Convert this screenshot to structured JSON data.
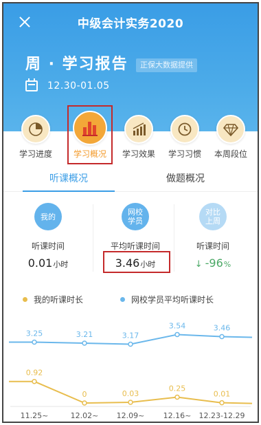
{
  "app": {
    "title": "中级会计实务2020"
  },
  "report": {
    "title": "周 · 学习报告",
    "source_tag": "正保大数据提供",
    "date_range": "12.30-01.05"
  },
  "categories": [
    {
      "label": "学习进度",
      "icon": "pie-chart-icon"
    },
    {
      "label": "学习概况",
      "icon": "bar-chart-icon",
      "active": true
    },
    {
      "label": "学习效果",
      "icon": "rising-bars-icon"
    },
    {
      "label": "学习习惯",
      "icon": "clock-icon"
    },
    {
      "label": "本周段位",
      "icon": "diamond-icon"
    }
  ],
  "tabs": [
    {
      "label": "听课概况",
      "active": true
    },
    {
      "label": "做题概况",
      "active": false
    }
  ],
  "stats": [
    {
      "badge": "我的",
      "label": "听课时间",
      "value": "0.01",
      "unit": "小时"
    },
    {
      "badge": "网校学员",
      "label": "平均听课时间",
      "value": "3.46",
      "unit": "小时"
    },
    {
      "badge": "对比上周",
      "label": "听课时间",
      "value": "-96",
      "unit": "%",
      "arrow": "↓"
    }
  ],
  "legend": {
    "mine": "我的听课时长",
    "average": "网校学员平均听课时长"
  },
  "colors": {
    "header_blue": "#3a9de6",
    "accent_orange": "#f3a738",
    "mine_series": "#e8bd4d",
    "average_series": "#6ab7eb",
    "highlight_red": "#c4292a",
    "positive_green": "#4aa865"
  },
  "chart_data": {
    "type": "line",
    "categories": [
      "11.25~",
      "12.02~",
      "12.09~",
      "12.16~",
      "12.23-12.29"
    ],
    "series": [
      {
        "name": "我的听课时长",
        "values": [
          0.92,
          0,
          0.03,
          0.25,
          0.01
        ],
        "labels": [
          "0.92",
          "0",
          "0.03",
          "0.25",
          "0.01"
        ]
      },
      {
        "name": "网校学员平均听课时长",
        "values": [
          3.25,
          3.21,
          3.17,
          3.54,
          3.46
        ],
        "labels": [
          "3.25",
          "3.21",
          "3.17",
          "3.54",
          "3.46"
        ]
      }
    ]
  }
}
